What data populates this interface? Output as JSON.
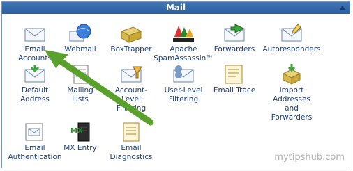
{
  "header": {
    "title": "Mail"
  },
  "items": [
    {
      "label": "Email\nAccounts",
      "icon": "envelope-icon"
    },
    {
      "label": "Webmail",
      "icon": "globe-mail-icon"
    },
    {
      "label": "BoxTrapper",
      "icon": "box-trap-icon"
    },
    {
      "label": "Apache\nSpamAssassin™",
      "icon": "spamassassin-icon",
      "logo_text": "SpamAssassin"
    },
    {
      "label": "Forwarders",
      "icon": "forward-mail-icon"
    },
    {
      "label": "Autoresponders",
      "icon": "autoresponder-icon"
    },
    {
      "label": "Default\nAddress",
      "icon": "default-address-icon"
    },
    {
      "label": "Mailing\nLists",
      "icon": "mailing-list-icon"
    },
    {
      "label": "Account-\nLevel\nFiltering",
      "icon": "filter-icon"
    },
    {
      "label": "User-Level\nFiltering",
      "icon": "user-filter-icon"
    },
    {
      "label": "Email Trace",
      "icon": "email-trace-icon"
    },
    {
      "label": "Import\nAddresses\nand\nForwarders",
      "icon": "import-icon"
    },
    {
      "label": "Email\nAuthentication",
      "icon": "auth-icon"
    },
    {
      "label": "MX Entry",
      "icon": "server-icon"
    },
    {
      "label": "Email\nDiagnostics",
      "icon": "diagnostics-icon"
    }
  ],
  "watermark": "mytipshub.com",
  "colors": {
    "header": "#2c5f9e",
    "link": "#1c3e73",
    "arrow": "#5aa02c"
  }
}
